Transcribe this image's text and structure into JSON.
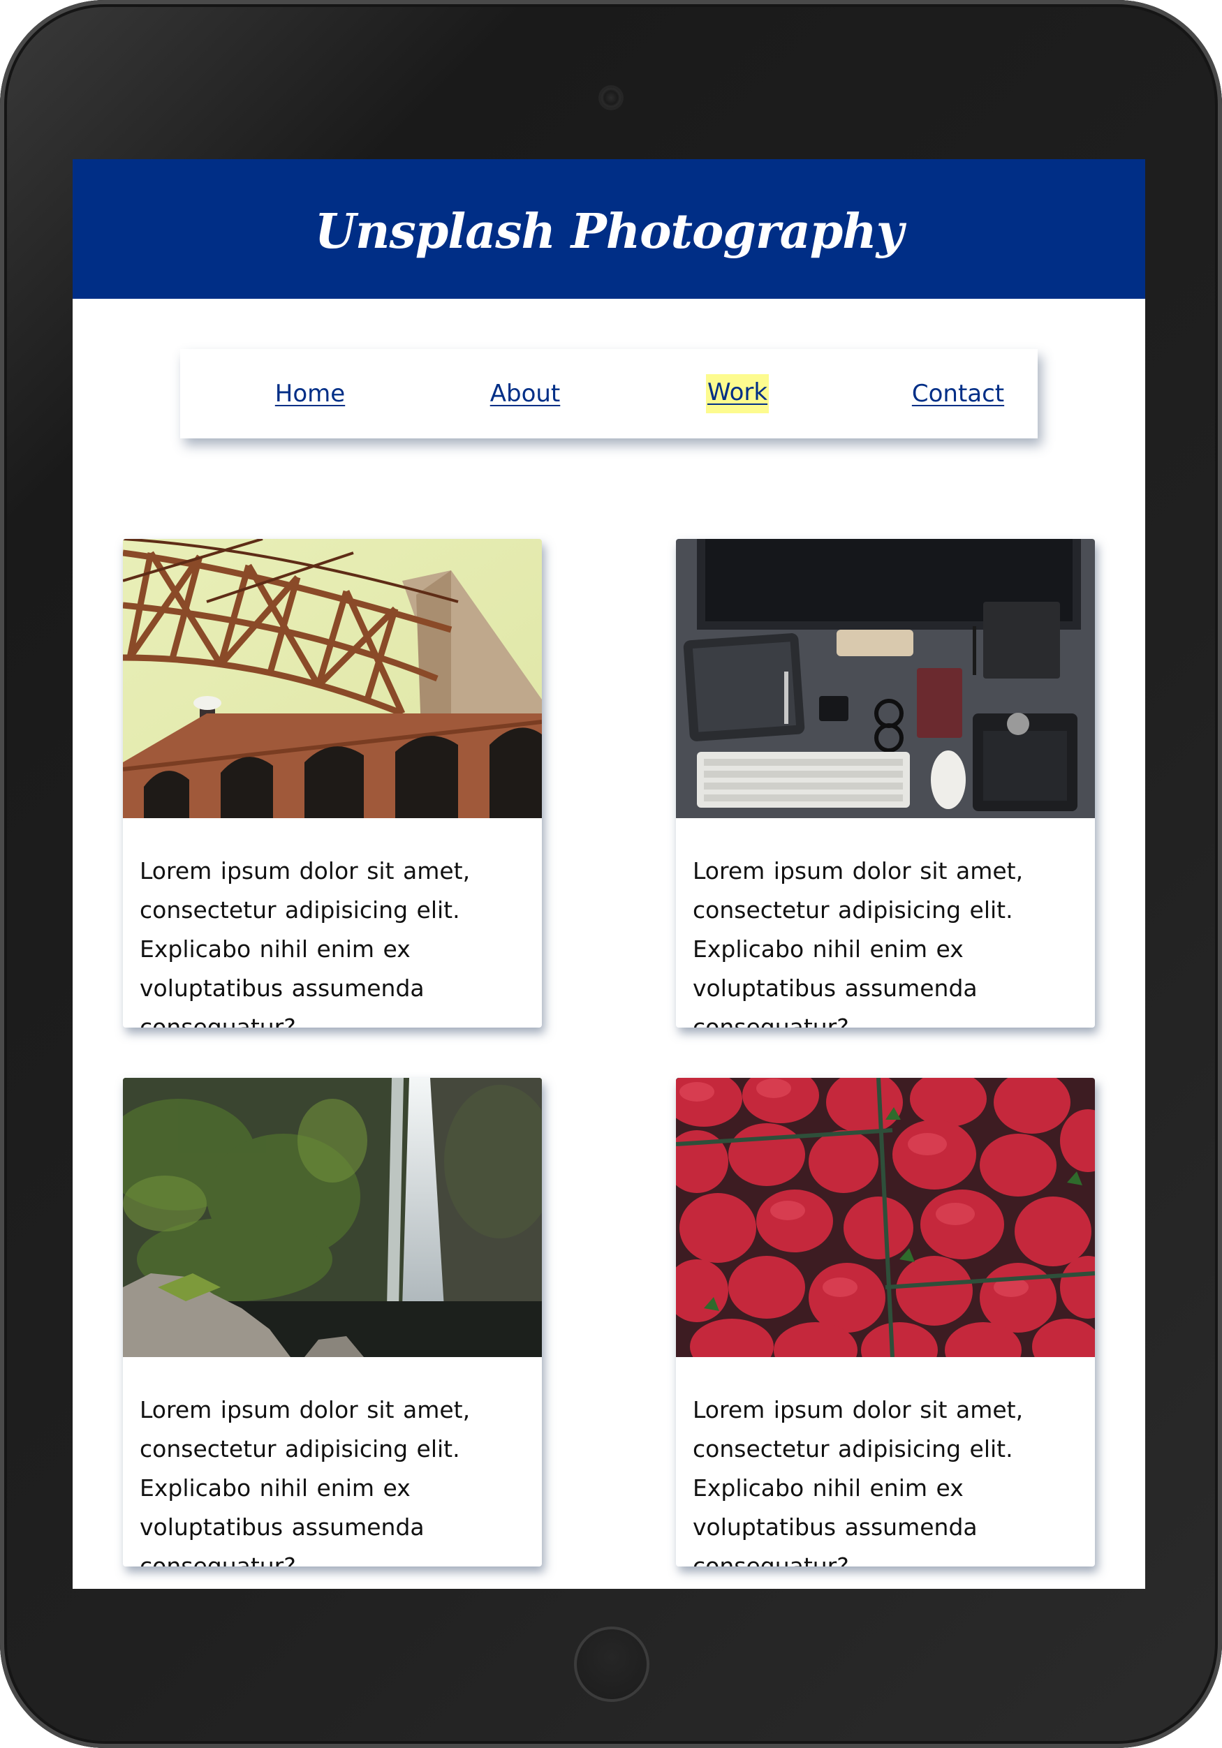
{
  "header": {
    "title": "Unsplash Photography"
  },
  "nav": {
    "items": [
      {
        "label": "Home"
      },
      {
        "label": "About"
      },
      {
        "label": "Work",
        "highlighted": true
      },
      {
        "label": "Contact"
      }
    ],
    "highlight_color": "#fdfb8f"
  },
  "colors": {
    "brand": "#002e86",
    "link": "#002e86",
    "device_frame": "#202020"
  },
  "cards": [
    {
      "image_name": "bridge-photo",
      "text": "Lorem ipsum dolor sit amet, consectetur adipisicing elit. Explicabo nihil enim ex voluptatibus assumenda consequatur?"
    },
    {
      "image_name": "desk-workspace-photo",
      "text": "Lorem ipsum dolor sit amet, consectetur adipisicing elit. Explicabo nihil enim ex voluptatibus assumenda consequatur?"
    },
    {
      "image_name": "waterfall-photo",
      "text": "Lorem ipsum dolor sit amet, consectetur adipisicing elit. Explicabo nihil enim ex voluptatibus assumenda consequatur?"
    },
    {
      "image_name": "strawberries-photo",
      "text": "Lorem ipsum dolor sit amet, consectetur adipisicing elit. Explicabo nihil enim ex voluptatibus assumenda consequatur?"
    }
  ]
}
